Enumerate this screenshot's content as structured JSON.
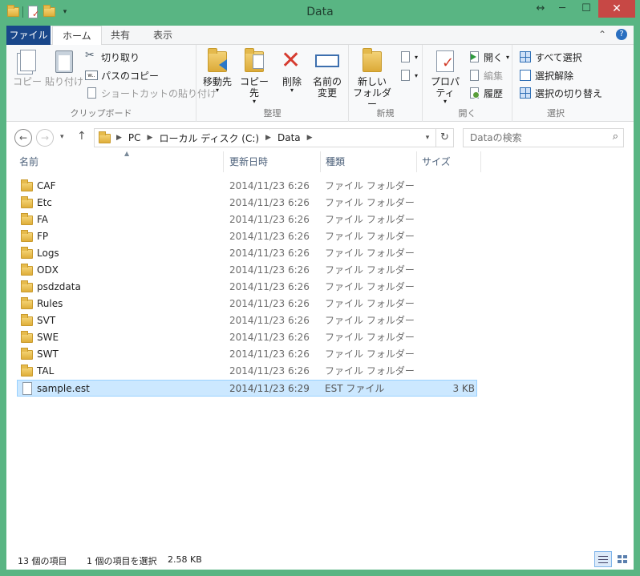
{
  "window": {
    "title": "Data"
  },
  "ribbon_tabs": {
    "file": "ファイル",
    "home": "ホーム",
    "share": "共有",
    "view": "表示"
  },
  "clipboard": {
    "copy": "コピー",
    "paste": "貼り付け",
    "cut": "切り取り",
    "copy_path": "パスのコピー",
    "paste_shortcut": "ショートカットの貼り付け",
    "group": "クリップボード"
  },
  "organize": {
    "move_to": "移動先",
    "copy_to": "コピー先",
    "delete": "削除",
    "rename_line1": "名前の",
    "rename_line2": "変更",
    "group": "整理"
  },
  "new": {
    "new_folder_line1": "新しい",
    "new_folder_line2": "フォルダー",
    "group": "新規"
  },
  "open": {
    "properties": "プロパティ",
    "open": "開く",
    "edit": "編集",
    "history": "履歴",
    "group": "開く"
  },
  "select": {
    "select_all": "すべて選択",
    "select_none": "選択解除",
    "invert": "選択の切り替え",
    "group": "選択"
  },
  "address": {
    "crumbs": [
      "PC",
      "ローカル ディスク (C:)",
      "Data"
    ]
  },
  "search": {
    "placeholder": "Dataの検索"
  },
  "columns": {
    "name": "名前",
    "date": "更新日時",
    "type": "種類",
    "size": "サイズ"
  },
  "files": [
    {
      "name": "CAF",
      "date": "2014/11/23 6:26",
      "type": "ファイル フォルダー",
      "size": "",
      "kind": "folder"
    },
    {
      "name": "Etc",
      "date": "2014/11/23 6:26",
      "type": "ファイル フォルダー",
      "size": "",
      "kind": "folder"
    },
    {
      "name": "FA",
      "date": "2014/11/23 6:26",
      "type": "ファイル フォルダー",
      "size": "",
      "kind": "folder"
    },
    {
      "name": "FP",
      "date": "2014/11/23 6:26",
      "type": "ファイル フォルダー",
      "size": "",
      "kind": "folder"
    },
    {
      "name": "Logs",
      "date": "2014/11/23 6:26",
      "type": "ファイル フォルダー",
      "size": "",
      "kind": "folder"
    },
    {
      "name": "ODX",
      "date": "2014/11/23 6:26",
      "type": "ファイル フォルダー",
      "size": "",
      "kind": "folder"
    },
    {
      "name": "psdzdata",
      "date": "2014/11/23 6:26",
      "type": "ファイル フォルダー",
      "size": "",
      "kind": "folder"
    },
    {
      "name": "Rules",
      "date": "2014/11/23 6:26",
      "type": "ファイル フォルダー",
      "size": "",
      "kind": "folder"
    },
    {
      "name": "SVT",
      "date": "2014/11/23 6:26",
      "type": "ファイル フォルダー",
      "size": "",
      "kind": "folder"
    },
    {
      "name": "SWE",
      "date": "2014/11/23 6:26",
      "type": "ファイル フォルダー",
      "size": "",
      "kind": "folder"
    },
    {
      "name": "SWT",
      "date": "2014/11/23 6:26",
      "type": "ファイル フォルダー",
      "size": "",
      "kind": "folder"
    },
    {
      "name": "TAL",
      "date": "2014/11/23 6:26",
      "type": "ファイル フォルダー",
      "size": "",
      "kind": "folder"
    },
    {
      "name": "sample.est",
      "date": "2014/11/23 6:29",
      "type": "EST ファイル",
      "size": "3 KB",
      "kind": "file",
      "selected": true
    }
  ],
  "status": {
    "count": "13 個の項目",
    "selected": "1 個の項目を選択",
    "size": "2.58 KB"
  },
  "colors": {
    "frame": "#59b583",
    "file_tab": "#19478a",
    "close": "#c74845",
    "selection": "#cce8ff"
  }
}
